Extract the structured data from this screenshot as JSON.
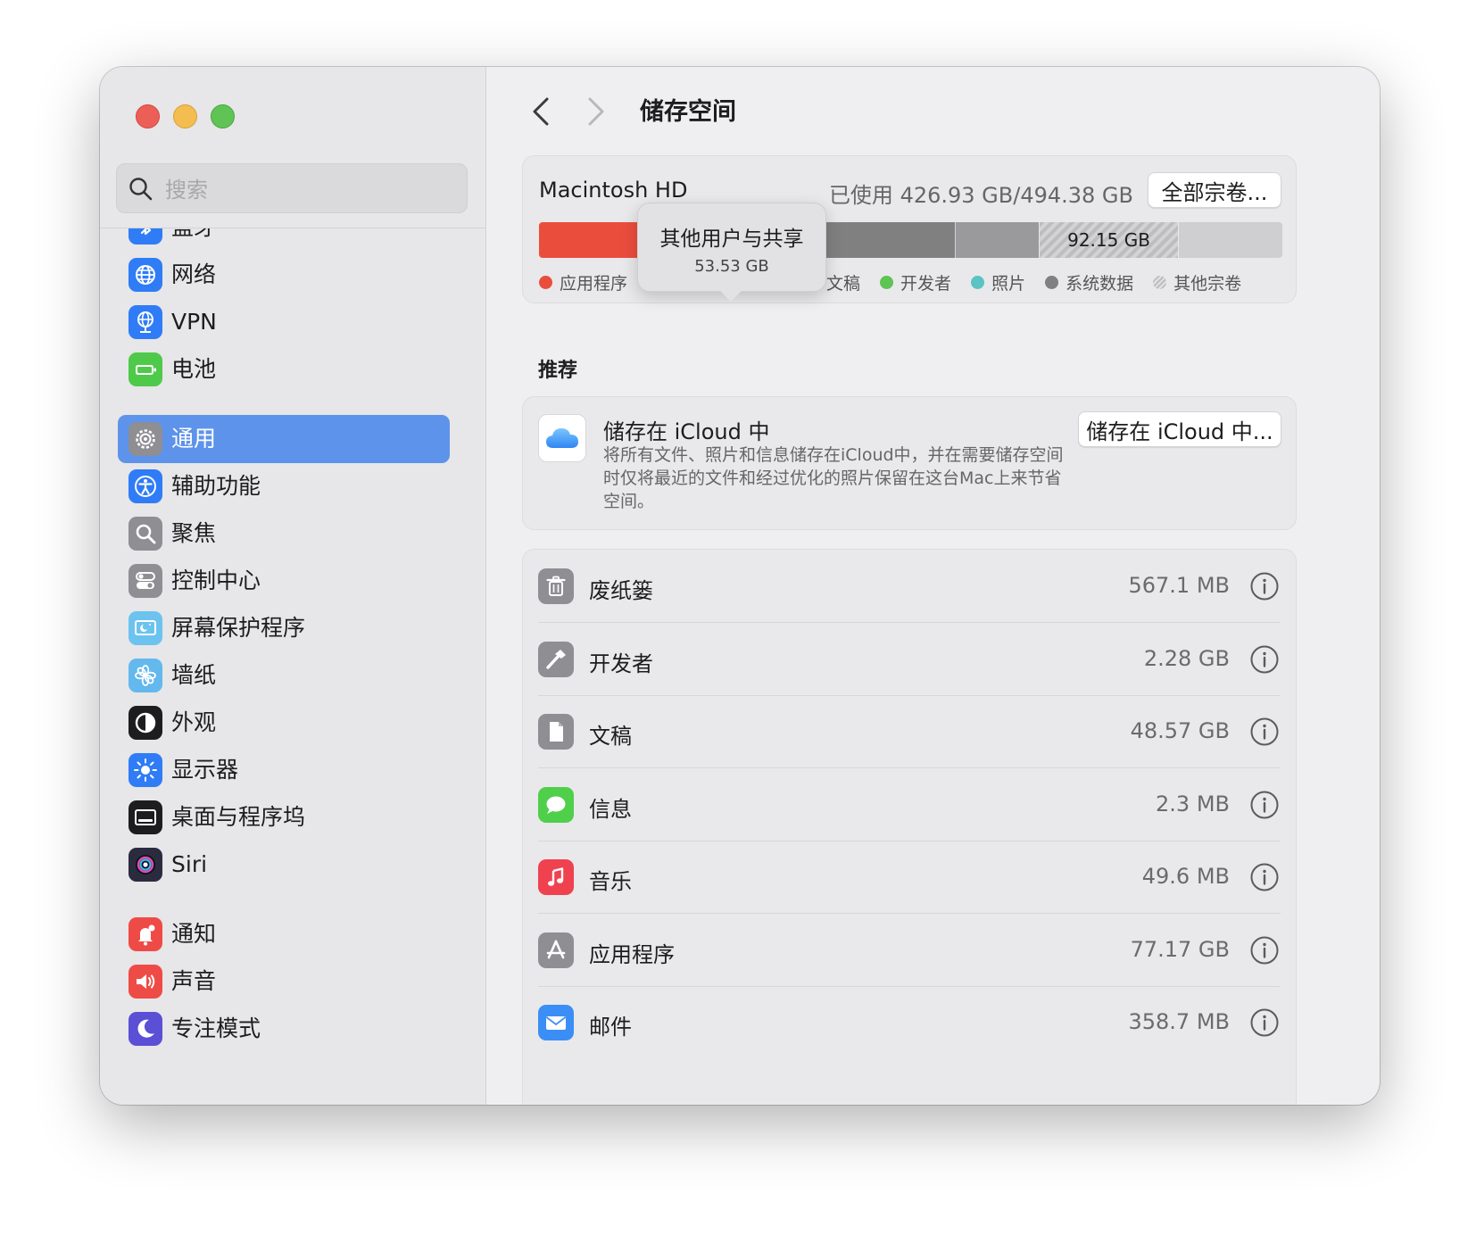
{
  "search": {
    "placeholder": "搜索"
  },
  "sidebar": {
    "items": [
      {
        "label": "蓝牙",
        "icon": "bluetooth-icon",
        "color": "#2f7cf6"
      },
      {
        "label": "网络",
        "icon": "globe-icon",
        "color": "#2f7cf6"
      },
      {
        "label": "VPN",
        "icon": "vpn-globe-icon",
        "color": "#2f7cf6"
      },
      {
        "label": "电池",
        "icon": "battery-icon",
        "color": "#4fc94a"
      },
      {
        "label": "通用",
        "icon": "gear-icon",
        "color": "#8e8e93",
        "selected": true
      },
      {
        "label": "辅助功能",
        "icon": "accessibility-icon",
        "color": "#2f7cf6"
      },
      {
        "label": "聚焦",
        "icon": "magnifier-icon",
        "color": "#8e8e93"
      },
      {
        "label": "控制中心",
        "icon": "switches-icon",
        "color": "#8e8e93"
      },
      {
        "label": "屏幕保护程序",
        "icon": "screensaver-icon",
        "color": "#6cc3f0"
      },
      {
        "label": "墙纸",
        "icon": "flower-icon",
        "color": "#63b8ee"
      },
      {
        "label": "外观",
        "icon": "appearance-icon",
        "color": "#1d1d1f"
      },
      {
        "label": "显示器",
        "icon": "sun-icon",
        "color": "#2f7cf6"
      },
      {
        "label": "桌面与程序坞",
        "icon": "dock-icon",
        "color": "#1d1d1f"
      },
      {
        "label": "Siri",
        "icon": "siri-icon",
        "color": "#2b2b40"
      },
      {
        "label": "通知",
        "icon": "bell-icon",
        "color": "#ef4b46"
      },
      {
        "label": "声音",
        "icon": "speaker-icon",
        "color": "#ef4b46"
      },
      {
        "label": "专注模式",
        "icon": "moon-icon",
        "color": "#5b4fd6"
      }
    ]
  },
  "header": {
    "title": "储存空间"
  },
  "storage": {
    "disk_name": "Macintosh HD",
    "used_text": "已使用 426.93 GB/494.38 GB",
    "all_volumes_button": "全部宗卷...",
    "tooltip": {
      "title": "其他用户与共享",
      "value": "53.53 GB"
    },
    "segments": [
      {
        "name": "应用程序",
        "fraction": 0.153,
        "color": "#eb4d3d"
      },
      {
        "name": "其他用户与共享",
        "fraction": 0.108,
        "color": "#f0952e"
      },
      {
        "name": "文稿",
        "fraction": 0.099,
        "color": "#f6c744"
      },
      {
        "name": "开发者",
        "fraction": 0.004,
        "color": "#5ec454"
      },
      {
        "name": "照片",
        "fraction": 0.005,
        "color": "#5bc3c4"
      },
      {
        "name": "系统数据",
        "fraction": 0.19,
        "color": "#808080"
      },
      {
        "name": "gray",
        "fraction": 0.113,
        "color": "#9a9a9c"
      },
      {
        "name": "其他宗卷",
        "fraction": 0.187,
        "color": "#bdbdbf",
        "label": "92.15 GB",
        "hatched": true
      },
      {
        "name": "free",
        "fraction": 0.141,
        "color": "#cfcfd1"
      }
    ],
    "legend": [
      {
        "label": "应用程序",
        "color": "#eb4d3d"
      },
      {
        "label": "其他用户与共享",
        "color": "#f0952e"
      },
      {
        "label": "文稿",
        "color": "#f6c744"
      },
      {
        "label": "开发者",
        "color": "#5ec454"
      },
      {
        "label": "照片",
        "color": "#5bc3c4"
      },
      {
        "label": "系统数据",
        "color": "#808080"
      },
      {
        "label": "其他宗卷",
        "color": "#cfcfd1"
      }
    ]
  },
  "recommend": {
    "section_title": "推荐",
    "icloud": {
      "title": "储存在 iCloud 中",
      "description": "将所有文件、照片和信息储存在iCloud中，并在需要储存空间时仅将最近的文件和经过优化的照片保留在这台Mac上来节省空间。",
      "button": "储存在 iCloud 中..."
    }
  },
  "categories": [
    {
      "name": "废纸篓",
      "size": "567.1 MB",
      "icon": "trash-icon",
      "color": "#8e8e93"
    },
    {
      "name": "开发者",
      "size": "2.28 GB",
      "icon": "hammer-icon",
      "color": "#8e8e93"
    },
    {
      "name": "文稿",
      "size": "48.57 GB",
      "icon": "document-icon",
      "color": "#8e8e93"
    },
    {
      "name": "信息",
      "size": "2.3 MB",
      "icon": "messages-icon",
      "color": "#4fcf4a"
    },
    {
      "name": "音乐",
      "size": "49.6 MB",
      "icon": "music-icon",
      "color": "#f0414f"
    },
    {
      "name": "应用程序",
      "size": "77.17 GB",
      "icon": "appstore-icon",
      "color": "#8e8e93"
    },
    {
      "name": "邮件",
      "size": "358.7 MB",
      "icon": "mail-icon",
      "color": "#3b8ef5"
    }
  ]
}
